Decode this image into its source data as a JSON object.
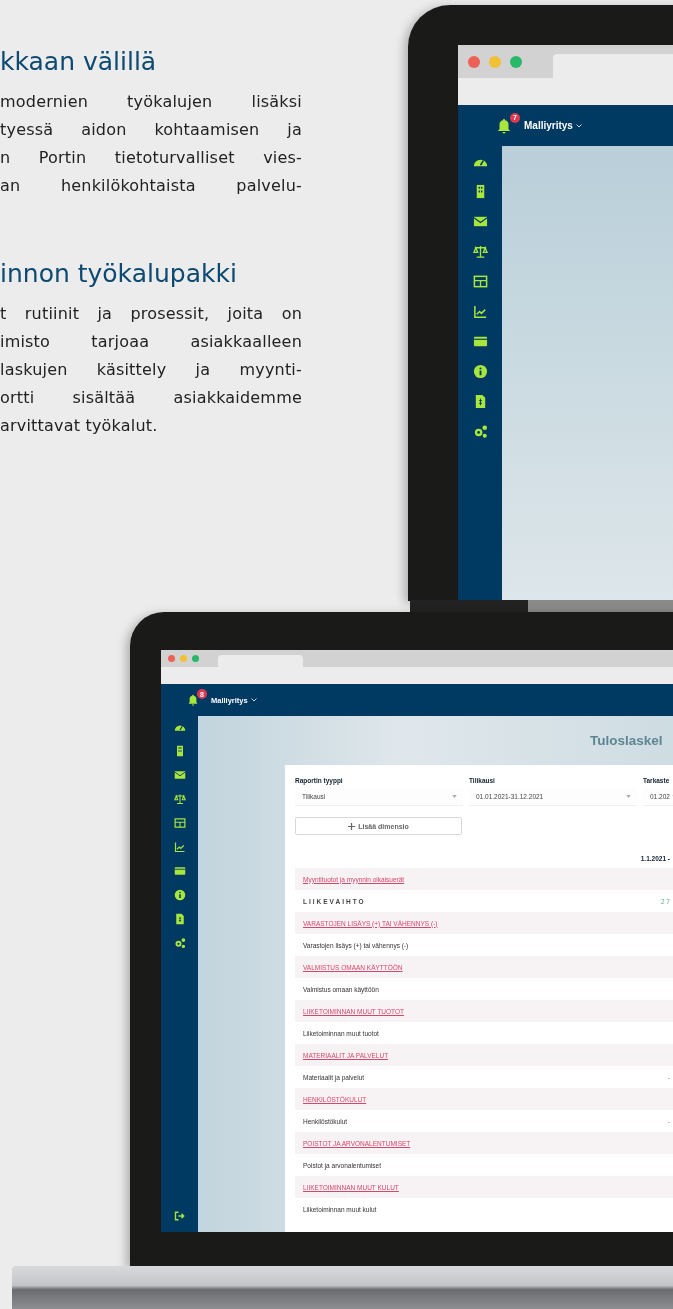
{
  "intro": {
    "sections": [
      {
        "heading": "kkaan välillä",
        "lines": [
          "modernien työkalujen lisäksi",
          "tyessä aidon kohtaamisen ja",
          "n Portin tietoturvalliset vies-",
          "an henkilökohtaista palvelu-"
        ]
      },
      {
        "heading": "innon työkalupakki",
        "lines": [
          "t rutiinit ja prosessit, joita on",
          "imisto tarjoaa asiakkaalleen",
          "laskujen käsittely ja myynti-",
          "ortti sisältää asiakkaidemme",
          "arvittavat työkalut."
        ]
      }
    ]
  },
  "laptop_back": {
    "screen": {
      "notification_count": "7",
      "company": "Malliyritys"
    }
  },
  "laptop_front": {
    "screen": {
      "notification_count": "8",
      "company": "Malliyritys",
      "page_title": "Tuloslaskel",
      "filters": [
        {
          "label": "Raportin tyyppi",
          "value": "Tilikausi"
        },
        {
          "label": "Tilikausi",
          "value": "01.01.2021-31.12.2021"
        },
        {
          "label": "Tarkaste",
          "value": "01.202"
        }
      ],
      "add_button": "Lisää dimensio",
      "column_header": "1.1.2021 -",
      "rows": [
        {
          "kind": "link",
          "label": "Myyntituotot ja myynnin oikaisuerät"
        },
        {
          "kind": "total",
          "label": "LIIKEVAIHTO",
          "value": "2 7"
        },
        {
          "kind": "link",
          "label": "VARASTOJEN LISÄYS (+) TAI VÄHENNYS (-)"
        },
        {
          "kind": "item",
          "label": "Varastojen lisäys (+) tai vähennys (-)"
        },
        {
          "kind": "link",
          "label": "VALMISTUS OMAAN KÄYTTÖÖN"
        },
        {
          "kind": "item",
          "label": "Valmistus omaan käyttöön"
        },
        {
          "kind": "link",
          "label": "LIIKETOIMINNAN MUUT TUOTOT"
        },
        {
          "kind": "item",
          "label": "Liiketoiminnan muut tuotot"
        },
        {
          "kind": "link",
          "label": "MATERIAALIT JA PALVELUT"
        },
        {
          "kind": "item",
          "label": "Materiaalit ja palvelut",
          "value": "-"
        },
        {
          "kind": "link",
          "label": "HENKILÖSTÖKULUT"
        },
        {
          "kind": "item",
          "label": "Henkilöstökulut",
          "value": "-"
        },
        {
          "kind": "link",
          "label": "POISTOT JA ARVONALENTUMISET"
        },
        {
          "kind": "item",
          "label": "Poistot ja arvonalentumiset"
        },
        {
          "kind": "link",
          "label": "LIIKETOIMINNAN MUUT KULUT"
        },
        {
          "kind": "item",
          "label": "Liiketoiminnan muut kulut"
        }
      ]
    }
  }
}
